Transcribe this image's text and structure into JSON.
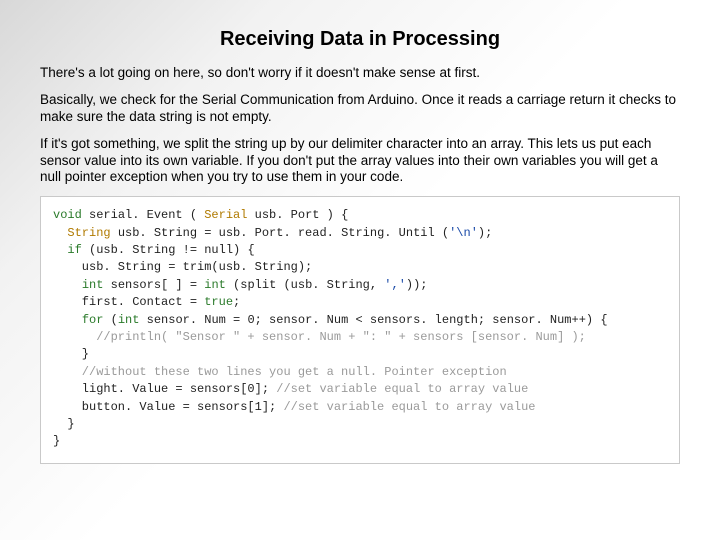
{
  "title": "Receiving Data in Processing",
  "paragraphs": {
    "p1": "There's a lot going on here, so don't worry if it doesn't make sense at first.",
    "p2": "Basically, we check for the Serial Communication from Arduino. Once it reads a carriage return it checks to make sure the data string is not empty.",
    "p3": "If it's got something, we split the string up by our delimiter character into an array.  This lets us put each sensor value into its own variable. If you don't put the array values into their own variables you will get a null pointer exception when you try to use them in your code."
  },
  "code": {
    "l1_kw": "void",
    "l1_fn": " serial. Event ( ",
    "l1_ty": "Serial",
    "l1_arg": " usb. Port ) {",
    "l2_ty": "String",
    "l2_rest": " usb. String = usb. Port. read. String. Until (",
    "l2_lit": "'\\n'",
    "l2_end": ");",
    "l3_kw": "if",
    "l3_rest": " (usb. String != null) {",
    "l4": "    usb. String = trim(usb. String);",
    "l5_kw": "int",
    "l5_mid": " sensors[ ] = ",
    "l5_kw2": "int",
    "l5_rest": " (split (usb. String, ",
    "l5_lit": "','",
    "l5_end": "));",
    "l6_a": "    first. Contact = ",
    "l6_kw": "true",
    "l6_b": ";",
    "l7_kw": "for",
    "l7_a": " (",
    "l7_kw2": "int",
    "l7_rest": " sensor. Num = 0; sensor. Num < sensors. length; sensor. Num++) {",
    "l8_cm": "      //println( \"Sensor \" + sensor. Num + \": \" + sensors [sensor. Num] );",
    "l9": "    }",
    "l10_cm": "    //without these two lines you get a null. Pointer exception",
    "l11_a": "    light. Value = sensors[0]; ",
    "l11_cm": "//set variable equal to array value",
    "l12_a": "    button. Value = sensors[1]; ",
    "l12_cm": "//set variable equal to array value",
    "l13": "  }",
    "l14": "}"
  }
}
